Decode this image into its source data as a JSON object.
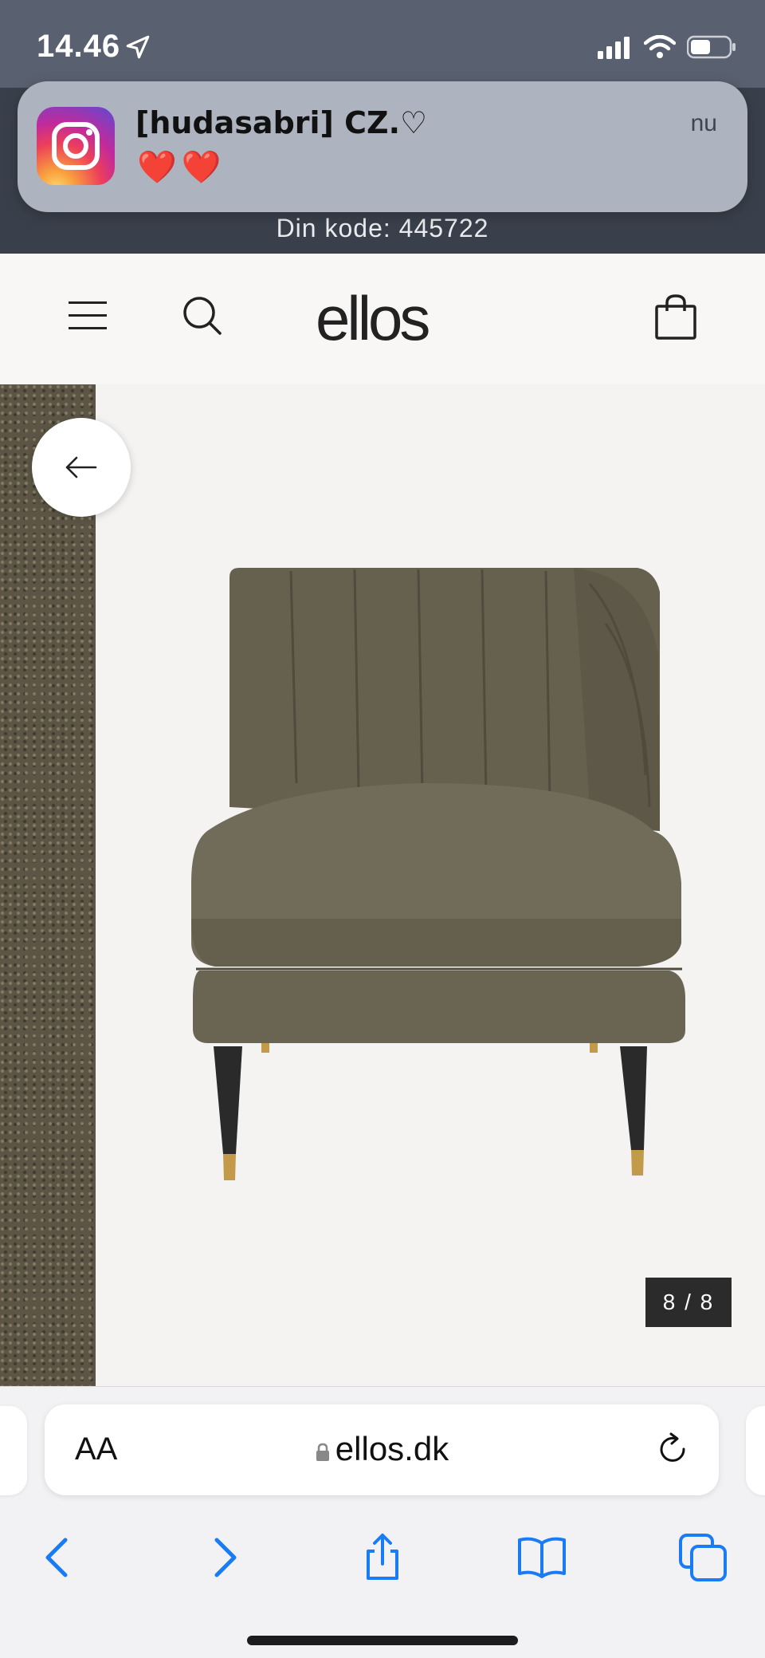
{
  "status_bar": {
    "time": "14.46"
  },
  "notification": {
    "app_icon": "instagram-icon",
    "title": "[hudasabri] CZ.♡",
    "body": "❤️❤️",
    "time": "nu"
  },
  "code_banner": "Din kode: 445722",
  "site_header": {
    "logo": "ellos",
    "icons": [
      "menu-icon",
      "search-icon",
      "shopping-bag-icon"
    ]
  },
  "gallery": {
    "counter": "8 / 8",
    "back_icon": "arrow-left-icon"
  },
  "browser": {
    "text_size_label": "AA",
    "url": "ellos.dk",
    "toolbar_icons": [
      "back-icon",
      "forward-icon",
      "share-icon",
      "bookmarks-icon",
      "tabs-icon"
    ]
  },
  "colors": {
    "status_bar_bg": "#596170",
    "accent_blue": "#1a7cf5",
    "chair_fabric": "#6b6655"
  }
}
